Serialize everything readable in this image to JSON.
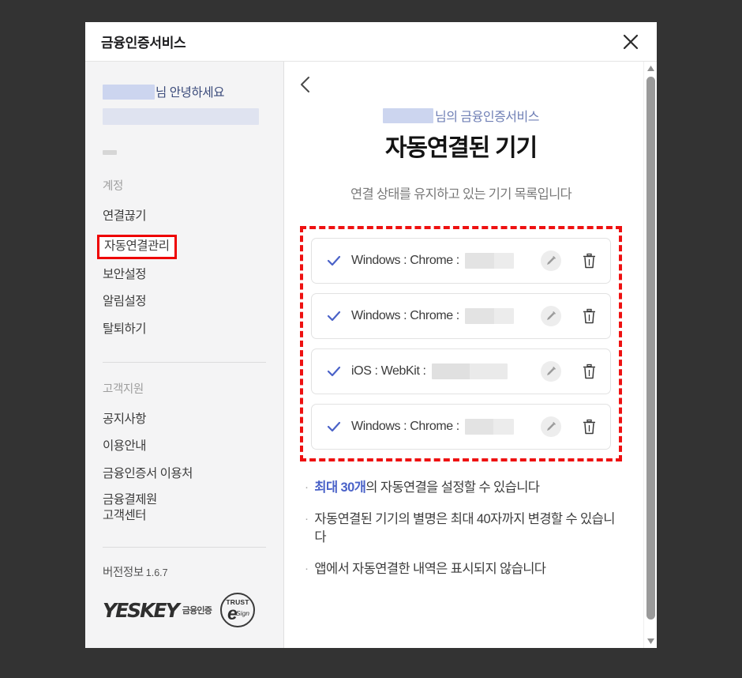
{
  "window": {
    "title": "금융인증서비스",
    "close_icon": "close-icon"
  },
  "sidebar": {
    "greeting_suffix": "님 안녕하세요",
    "account_group_label": "계정",
    "account_items": [
      {
        "label": "연결끊기",
        "highlighted": false
      },
      {
        "label": "자동연결관리",
        "highlighted": true
      },
      {
        "label": "보안설정",
        "highlighted": false
      },
      {
        "label": "알림설정",
        "highlighted": false
      },
      {
        "label": "탈퇴하기",
        "highlighted": false
      }
    ],
    "support_group_label": "고객지원",
    "support_items": [
      {
        "label": "공지사항"
      },
      {
        "label": "이용안내"
      },
      {
        "label": "금융인증서 이용처"
      },
      {
        "label": "금융결제원\n고객센터"
      }
    ],
    "version_label": "버전정보",
    "version_number": "1.6.7",
    "logo": {
      "wordmark": "YESKEY",
      "subtext": "금융인증",
      "badge_top": "TRUST",
      "badge_mark": "e",
      "badge_bottom": "Sign"
    }
  },
  "main": {
    "back_icon": "chevron-left-icon",
    "subtitle_suffix": "님의 금융인증서비스",
    "title": "자동연결된 기기",
    "description": "연결 상태를 유지하고 있는 기기 목록입니다",
    "devices": [
      {
        "label": "Windows : Chrome :",
        "check_icon": "check-icon",
        "edit_icon": "pencil-icon",
        "delete_icon": "trash-icon"
      },
      {
        "label": "Windows : Chrome :",
        "check_icon": "check-icon",
        "edit_icon": "pencil-icon",
        "delete_icon": "trash-icon"
      },
      {
        "label": "iOS : WebKit :",
        "check_icon": "check-icon",
        "edit_icon": "pencil-icon",
        "delete_icon": "trash-icon"
      },
      {
        "label": "Windows : Chrome :",
        "check_icon": "check-icon",
        "edit_icon": "pencil-icon",
        "delete_icon": "trash-icon"
      }
    ],
    "notes": [
      {
        "bullet": "·",
        "accent": "최대 30개",
        "rest": "의 자동연결을 설정할 수 있습니다"
      },
      {
        "bullet": "·",
        "accent": "",
        "rest": "자동연결된 기기의 별명은 최대 40자까지 변경할 수 있습니다"
      },
      {
        "bullet": "·",
        "accent": "",
        "rest": "앱에서 자동연결한 내역은 표시되지 않습니다"
      }
    ]
  },
  "scrollbar": {
    "up_icon": "caret-up-icon",
    "down_icon": "caret-down-icon"
  },
  "colors": {
    "accent_blue": "#4a62c8",
    "highlight_red": "#ee1111",
    "page_background": "#333333"
  }
}
